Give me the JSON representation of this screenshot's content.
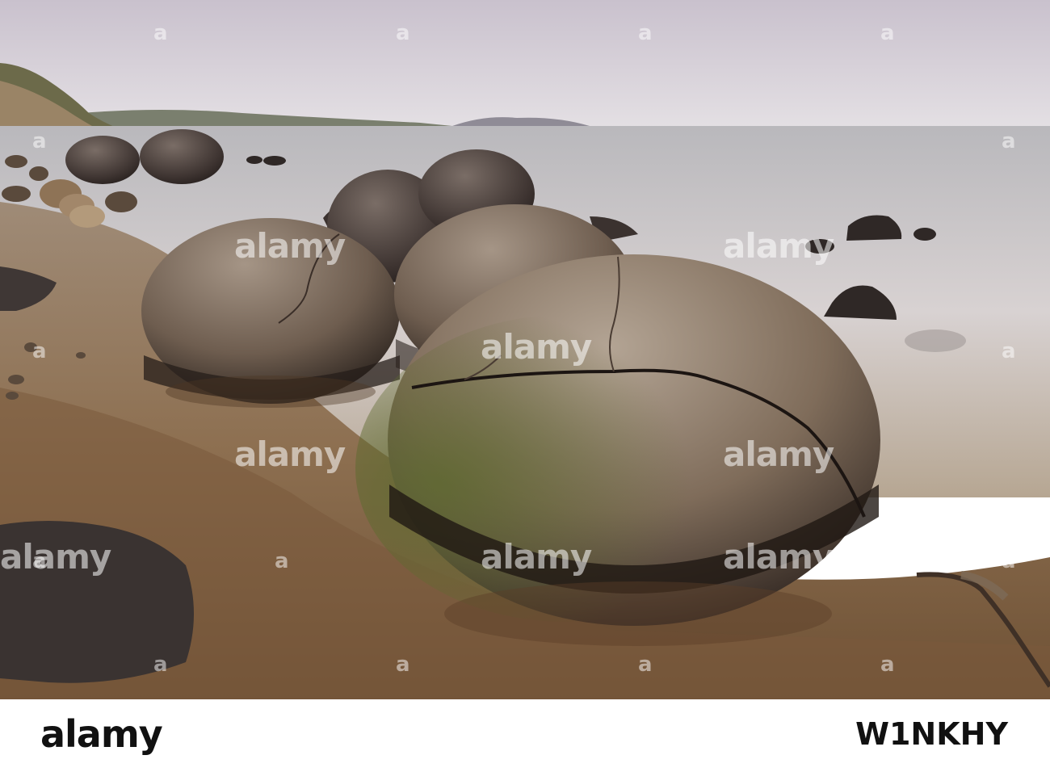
{
  "watermark": {
    "text": "alamy",
    "small_mark": "a"
  },
  "footer": {
    "logo": "alamy",
    "image_id": "W1NKHY"
  },
  "colors": {
    "sky": "#d9d4dc",
    "sea": "#cfc9cc",
    "sand": "#8a6b4c",
    "boulder": "#7a6656",
    "footer_bg": "#ffffff",
    "footer_text": "#111111"
  },
  "icons": [
    "alamy-logo"
  ]
}
